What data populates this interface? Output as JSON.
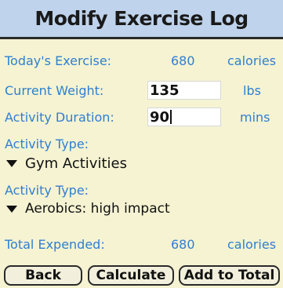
{
  "title": "Modify Exercise Log",
  "todays_exercise": {
    "label": "Today's Exercise:",
    "value": "680",
    "unit": "calories"
  },
  "current_weight": {
    "label": "Current Weight:",
    "value": "135",
    "unit": "lbs"
  },
  "activity_duration": {
    "label": "Activity Duration:",
    "value": "90",
    "unit": "mins"
  },
  "activity_type_1": {
    "label": "Activity Type:",
    "selected": "Gym Activities"
  },
  "activity_type_2": {
    "label": "Activity Type:",
    "selected": "Aerobics: high impact"
  },
  "total_expended": {
    "label": "Total Expended:",
    "value": "680",
    "unit": "calories"
  },
  "buttons": {
    "back": "Back",
    "calculate": "Calculate",
    "add_to_total": "Add to Total"
  },
  "colors": {
    "title_bar": "#bfd3ec",
    "background": "#f5f3d2",
    "label_blue": "#2f7fd2"
  },
  "icons": {
    "dropdown": "triangle-down-icon"
  }
}
